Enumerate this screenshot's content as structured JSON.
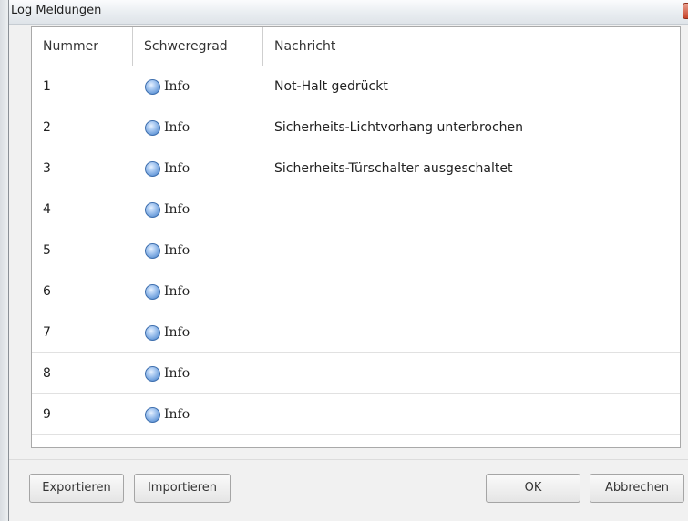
{
  "window": {
    "title": "Log Meldungen",
    "close_glyph": "x"
  },
  "table": {
    "headers": [
      "Nummer",
      "Schweregrad",
      "Nachricht"
    ],
    "rows": [
      {
        "nummer": "1",
        "severity": "Info",
        "message": "Not-Halt gedrückt"
      },
      {
        "nummer": "2",
        "severity": "Info",
        "message": "Sicherheits-Lichtvorhang unterbrochen"
      },
      {
        "nummer": "3",
        "severity": "Info",
        "message": "Sicherheits-Türschalter ausgeschaltet"
      },
      {
        "nummer": "4",
        "severity": "Info",
        "message": ""
      },
      {
        "nummer": "5",
        "severity": "Info",
        "message": ""
      },
      {
        "nummer": "6",
        "severity": "Info",
        "message": ""
      },
      {
        "nummer": "7",
        "severity": "Info",
        "message": ""
      },
      {
        "nummer": "8",
        "severity": "Info",
        "message": ""
      },
      {
        "nummer": "9",
        "severity": "Info",
        "message": ""
      }
    ],
    "severity_icon": "info-circle-icon",
    "severity_color": "#5f94d6"
  },
  "buttons": {
    "export": "Exportieren",
    "import": "Importieren",
    "ok": "OK",
    "cancel": "Abbrechen"
  }
}
